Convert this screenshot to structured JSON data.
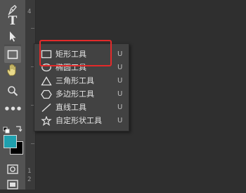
{
  "toolbar": {
    "tools": [
      {
        "name": "pen-tool",
        "icon": "pen-icon"
      },
      {
        "name": "type-tool",
        "icon": "type-icon",
        "glyph": "T"
      },
      {
        "name": "path-selection-tool",
        "icon": "arrow-icon"
      },
      {
        "name": "rectangle-tool",
        "icon": "rectangle-icon",
        "active": true
      },
      {
        "name": "hand-tool",
        "icon": "hand-icon"
      },
      {
        "name": "zoom-tool",
        "icon": "magnifier-icon"
      },
      {
        "name": "more-tools",
        "icon": "ellipsis-icon",
        "glyph": "•••"
      },
      {
        "name": "screen-mode",
        "icon": "screen-mode-icon"
      }
    ],
    "foreground_color": "#1fa0ae",
    "background_color": "#000000"
  },
  "ruler": {
    "ticks": [
      "4",
      "1",
      "2"
    ]
  },
  "flyout": {
    "items": [
      {
        "label": "矩形工具",
        "shortcut": "U",
        "icon": "rectangle-icon"
      },
      {
        "label": "椭圆工具",
        "shortcut": "U",
        "icon": "ellipse-icon"
      },
      {
        "label": "三角形工具",
        "shortcut": "U",
        "icon": "triangle-icon"
      },
      {
        "label": "多边形工具",
        "shortcut": "U",
        "icon": "polygon-icon"
      },
      {
        "label": "直线工具",
        "shortcut": "U",
        "icon": "line-icon"
      },
      {
        "label": "自定形状工具",
        "shortcut": "U",
        "icon": "custom-shape-icon"
      }
    ]
  },
  "colors": {
    "highlight": "#e32a2a",
    "panel": "#424242",
    "toolbar": "#535353"
  }
}
